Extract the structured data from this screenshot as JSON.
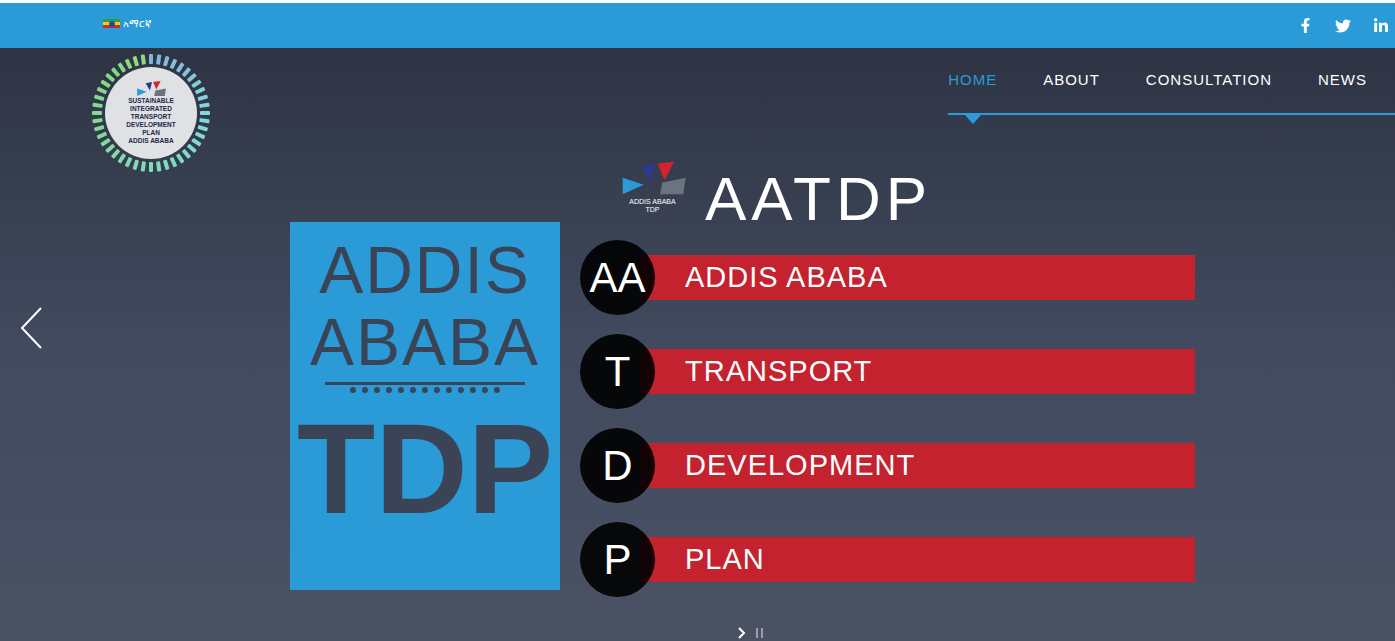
{
  "topbar": {
    "language": "አማርኛ"
  },
  "logo": {
    "lines": [
      "SUSTAINABLE",
      "INTEGRATED",
      "TRANSPORT",
      "DEVELOPMENT",
      "PLAN",
      "ADDIS ABABA"
    ]
  },
  "nav": [
    {
      "label": "HOME",
      "selected": true
    },
    {
      "label": "ABOUT",
      "selected": false
    },
    {
      "label": "CONSULTATION",
      "selected": false
    },
    {
      "label": "NEWS",
      "selected": false
    }
  ],
  "hero": {
    "title": "AATDP",
    "badge": {
      "lines": [
        "ADDIS ABABA",
        "TDP"
      ]
    },
    "poster": {
      "lines": [
        "ADDIS",
        "ABABA",
        "TDP"
      ]
    },
    "rows": [
      {
        "letter": "AA",
        "label": "ADDIS ABABA"
      },
      {
        "letter": "T",
        "label": "TRANSPORT"
      },
      {
        "letter": "D",
        "label": "DEVELOPMENT"
      },
      {
        "letter": "P",
        "label": "PLAN"
      }
    ]
  }
}
